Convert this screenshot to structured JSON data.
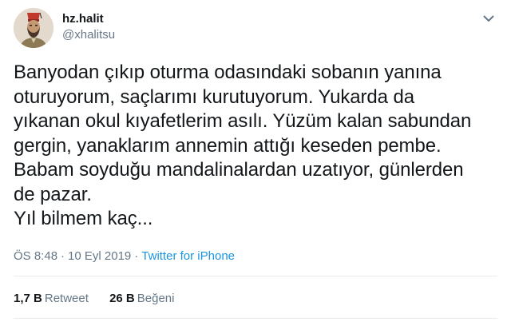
{
  "author": {
    "display_name": "hz.halit",
    "handle": "@xhalitsu"
  },
  "icons": {
    "more": "chevron-down-icon",
    "avatar": "profile-photo"
  },
  "tweet": {
    "text": "Banyodan çıkıp oturma odasındaki sobanın yanına\noturuyorum, saçlarımı  kurutuyorum. Yukarda da\nyıkanan okul kıyafetlerim asılı. Yüzüm kalan sabundan\ngergin, yanaklarım annemin attığı keseden pembe.\nBabam soyduğu mandalinalardan uzatıyor, günlerden\nde pazar.\nYıl bilmem kaç...",
    "time": "ÖS 8:48",
    "separator_1": "·",
    "date": "10 Eyl 2019",
    "separator_2": "·",
    "source": "Twitter for iPhone"
  },
  "stats": {
    "retweets_count": "1,7 B",
    "retweets_label": "Retweet",
    "likes_count": "26 B",
    "likes_label": "Beğeni"
  },
  "colors": {
    "text": "#14171a",
    "secondary": "#657786",
    "link": "#1b95e0",
    "divider": "#e6ecf0"
  }
}
